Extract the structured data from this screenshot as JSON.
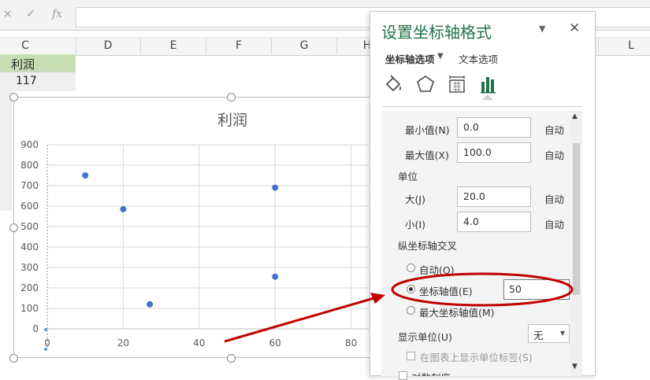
{
  "formula_bar": {
    "cancel_glyph": "×",
    "confirm_glyph": "✓",
    "fx_label": "fx",
    "value": ""
  },
  "columns": [
    "C",
    "D",
    "E",
    "F",
    "G",
    "H",
    "L"
  ],
  "cells": {
    "c1": "利润",
    "c2": "117"
  },
  "chart_data": {
    "type": "scatter",
    "title": "利润",
    "x": [
      10,
      20,
      27,
      60,
      60
    ],
    "y": [
      750,
      585,
      120,
      690,
      255
    ],
    "xlim": [
      0,
      100
    ],
    "ylim": [
      0,
      900
    ],
    "x_ticks": [
      0,
      20,
      40,
      60,
      80
    ],
    "y_ticks": [
      0,
      100,
      200,
      300,
      400,
      500,
      600,
      700,
      800,
      900
    ],
    "grid": true,
    "marker_color": "#4472c4"
  },
  "pane": {
    "title": "设置坐标轴格式",
    "title_color": "#217346",
    "tab_axis_options": "坐标轴选项",
    "tab_text_options": "文本选项",
    "icons": [
      "fill-line-icon",
      "effects-pentagon-icon",
      "size-properties-icon",
      "axis-options-bars-icon"
    ],
    "accent_color": "#217346",
    "min_label": "最小值(N)",
    "min_value": "0.0",
    "max_label": "最大值(X)",
    "max_value": "100.0",
    "auto_label": "自动",
    "units_header": "单位",
    "major_label": "大(J)",
    "major_value": "20.0",
    "minor_label": "小(I)",
    "minor_value": "4.0",
    "cross_header": "纵坐标轴交叉",
    "cross_auto": "自动(O)",
    "cross_value_label": "坐标轴值(E)",
    "cross_value": "50",
    "cross_max": "最大坐标轴值(M)",
    "display_units_label": "显示单位(U)",
    "display_units_value": "无",
    "show_units_label": "在图表上显示单位标签(S)",
    "log_scale_label": "对数刻度"
  },
  "annotation": {
    "color": "#c00000"
  }
}
